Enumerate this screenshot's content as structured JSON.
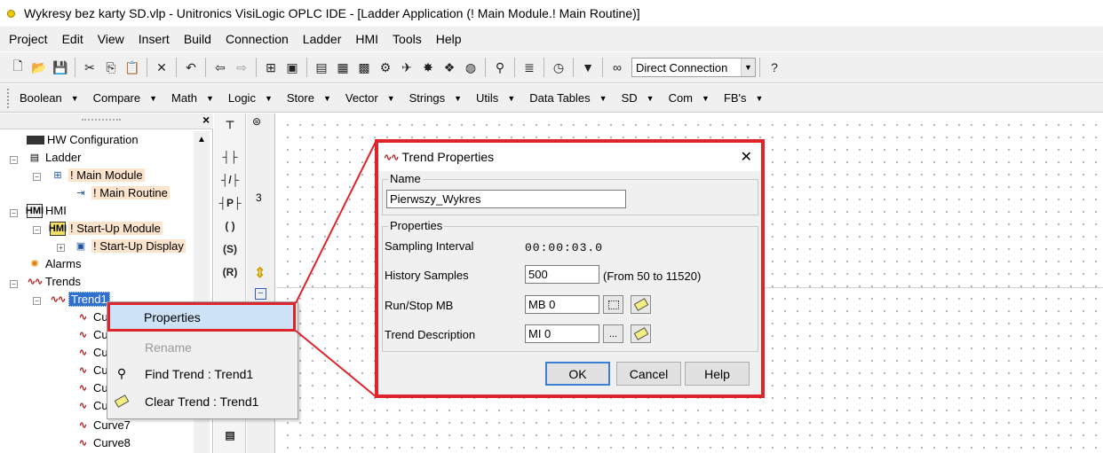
{
  "window": {
    "title": "Wykresy bez karty SD.vlp - Unitronics VisiLogic OPLC IDE - [Ladder Application (! Main Module.! Main Routine)]"
  },
  "menu": [
    "Project",
    "Edit",
    "View",
    "Insert",
    "Build",
    "Connection",
    "Ladder",
    "HMI",
    "Tools",
    "Help"
  ],
  "toolbar": {
    "connection": "Direct Connection"
  },
  "function_toolbar": [
    "Boolean",
    "Compare",
    "Math",
    "Logic",
    "Store",
    "Vector",
    "Strings",
    "Utils",
    "Data Tables",
    "SD",
    "Com",
    "FB's"
  ],
  "tree": {
    "hw": "HW Configuration",
    "ladder": "Ladder",
    "main_module": "! Main Module",
    "main_routine": "! Main Routine",
    "hmi": "HMI",
    "startup_module": "! Start-Up Module",
    "startup_display": "! Start-Up Display",
    "alarms": "Alarms",
    "trends": "Trends",
    "trend1": "Trend1",
    "curves": [
      "Cu",
      "Cu",
      "Cu",
      "Cu",
      "Cu",
      "Cu",
      "Curve7",
      "Curve8"
    ]
  },
  "palette": {
    "contacts": [
      "┤├",
      "┤/├",
      "┤P├",
      "( )",
      "(S)",
      "(R)"
    ]
  },
  "rung": {
    "number": "3",
    "collapse": "−"
  },
  "context_menu": {
    "properties": "Properties",
    "rename": "Rename",
    "find": "Find  Trend : Trend1",
    "clear": "Clear Trend :  Trend1"
  },
  "dialog": {
    "title": "Trend Properties",
    "name_group": "Name",
    "name_value": "Pierwszy_Wykres",
    "props_group": "Properties",
    "sampling_label": "Sampling Interval",
    "sampling_value": "00:00:03.0",
    "history_label": "History Samples",
    "history_value": "500",
    "history_hint": "(From 50 to 11520)",
    "runstop_label": "Run/Stop MB",
    "runstop_value": "MB 0",
    "desc_label": "Trend Description",
    "desc_value": "MI 0",
    "desc_browse": "...",
    "ok": "OK",
    "cancel": "Cancel",
    "help": "Help"
  },
  "colors": {
    "highlight_red": "#e0242c",
    "selection_blue": "#3070d0",
    "tree_highlight": "#fce4cc"
  }
}
